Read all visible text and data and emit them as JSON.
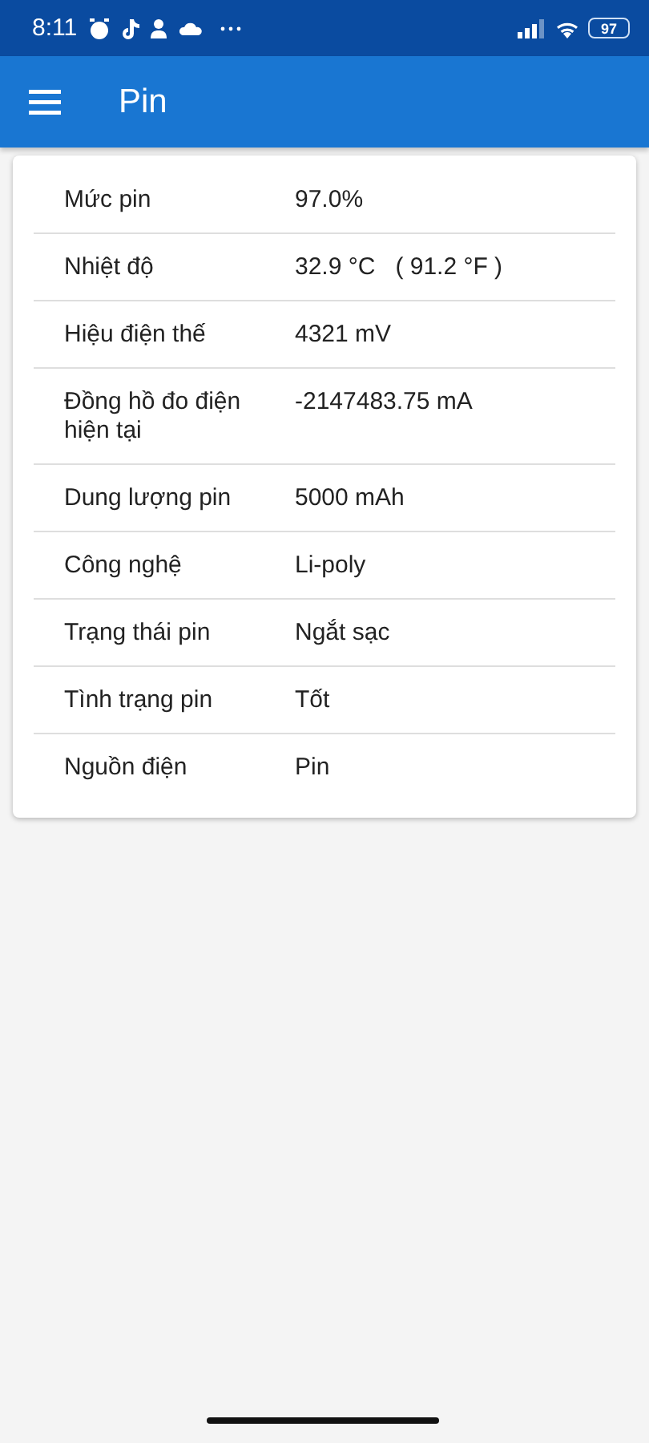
{
  "status_bar": {
    "time": "8:11",
    "battery": "97"
  },
  "app_bar": {
    "title": "Pin"
  },
  "rows": [
    {
      "label": "Mức pin",
      "value": "97.0%"
    },
    {
      "label": "Nhiệt độ",
      "value": "32.9 °C   ( 91.2 °F )"
    },
    {
      "label": "Hiệu điện thế",
      "value": "4321 mV"
    },
    {
      "label": "Đồng hồ đo điện hiện tại",
      "value": "-2147483.75 mA"
    },
    {
      "label": "Dung lượng pin",
      "value": "5000 mAh"
    },
    {
      "label": "Công nghệ",
      "value": "Li-poly"
    },
    {
      "label": "Trạng thái pin",
      "value": "Ngắt sạc"
    },
    {
      "label": "Tình trạng pin",
      "value": "Tốt"
    },
    {
      "label": "Nguồn điện",
      "value": "Pin"
    }
  ]
}
